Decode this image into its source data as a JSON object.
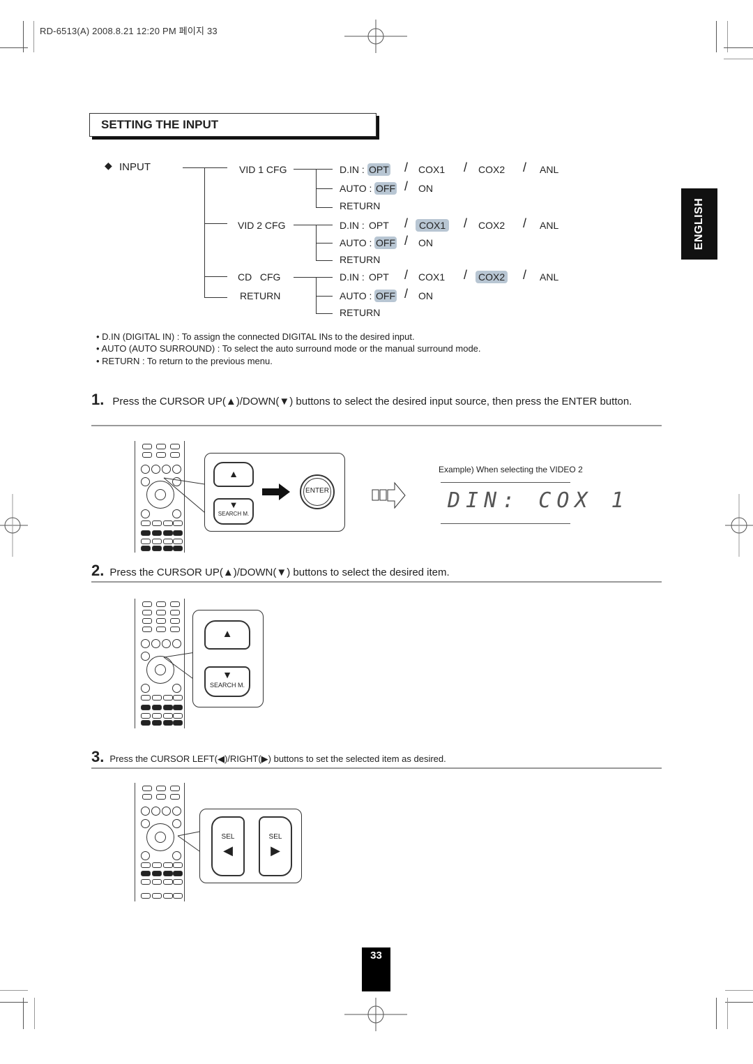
{
  "header": {
    "meta": "RD-6513(A)  2008.8.21  12:20 PM  페이지 33"
  },
  "section": {
    "title": "SETTING THE INPUT",
    "language_tab": "ENGLISH"
  },
  "menu_tree": {
    "root": "INPUT",
    "root_icon": "diamond-icon",
    "branches": [
      {
        "label": "VID 1 CFG",
        "items": [
          {
            "label": "D.IN :",
            "options": [
              "OPT",
              "COX1",
              "COX2",
              "ANL"
            ],
            "selected": "OPT"
          },
          {
            "label": "AUTO :",
            "options": [
              "OFF",
              "ON"
            ],
            "selected": "OFF"
          },
          {
            "label": "RETURN"
          }
        ]
      },
      {
        "label": "VID 2 CFG",
        "items": [
          {
            "label": "D.IN :",
            "options": [
              "OPT",
              "COX1",
              "COX2",
              "ANL"
            ],
            "selected": "COX1"
          },
          {
            "label": "AUTO :",
            "options": [
              "OFF",
              "ON"
            ],
            "selected": "OFF"
          },
          {
            "label": "RETURN"
          }
        ]
      },
      {
        "label": "CD   CFG",
        "items": [
          {
            "label": "D.IN :",
            "options": [
              "OPT",
              "COX1",
              "COX2",
              "ANL"
            ],
            "selected": "COX2"
          },
          {
            "label": "AUTO :",
            "options": [
              "OFF",
              "ON"
            ],
            "selected": "OFF"
          },
          {
            "label": "RETURN"
          }
        ]
      },
      {
        "label": "RETURN"
      }
    ],
    "separator": "/"
  },
  "notes": [
    "• D.IN (DIGITAL IN) : To assign the connected DIGITAL INs to the desired input.",
    "• AUTO (AUTO SURROUND) : To select the auto surround mode or the manual surround mode.",
    "• RETURN : To return to the previous menu."
  ],
  "steps": [
    {
      "number": "1.",
      "text": "Press the CURSOR UP(▲)/DOWN(▼) buttons to select the desired input source, then press the ENTER button."
    },
    {
      "number": "2.",
      "text": "Press the CURSOR UP(▲)/DOWN(▼) buttons to select the desired item."
    },
    {
      "number": "3.",
      "text": "Press the CURSOR LEFT(◀)/RIGHT(▶) buttons  to set the selected item as desired."
    }
  ],
  "illustrations": {
    "enter_label": "ENTER",
    "search_label": "SEARCH M.",
    "sel_label": "SEL",
    "up_glyph": "▲",
    "down_glyph": "▼",
    "left_glyph": "◀",
    "right_glyph": "▶",
    "example_caption": "Example) When selecting the VIDEO 2",
    "lcd_display": "DIN: COX 1"
  },
  "footer": {
    "page_number": "33"
  }
}
